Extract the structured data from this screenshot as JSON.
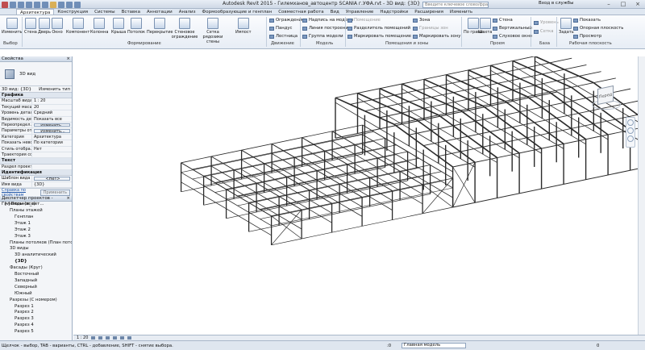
{
  "titlebar": {
    "app_title": "Autodesk Revit 2015 -   Гилемханов_автоцентр SCANIA г.УФА.rvt - 3D вид: {3D}",
    "search_placeholder": "Введите ключевое слово/фразу",
    "login": "Вход в службы"
  },
  "tabs": [
    "Архитектура",
    "Конструкция",
    "Системы",
    "Вставка",
    "Аннотации",
    "Анализ",
    "Формообразующие и генплан",
    "Совместная работа",
    "Вид",
    "Управление",
    "Надстройки",
    "Расширения",
    "Изменить"
  ],
  "active_tab": "Архитектура",
  "ribbon": {
    "modify": "Изменить",
    "select": "Выбор",
    "build": [
      "Стена",
      "Дверь",
      "Окно",
      "Компонент",
      "Колонна",
      "Крыша",
      "Потолок",
      "Перекрытие",
      "Стеновое ограждение",
      "Сетка рядозики стены",
      "Импост"
    ],
    "build_group": "Формирование",
    "circulation": [
      "Ограждение",
      "Пандус",
      "Лестница"
    ],
    "circulation_group": "Движение",
    "model": [
      "Надпись на модели",
      "Линия построения",
      "Группа модели"
    ],
    "model_group": "Модель",
    "room": [
      "Помещение",
      "Разделитель помещений",
      "Маркировать помещение",
      "Зона",
      "Границы зон",
      "Маркировать зону"
    ],
    "room_group": "Помещения и зоны",
    "opening": [
      "По грани",
      "Шахта",
      "Стена",
      "Вертикальный",
      "Слуховое окно"
    ],
    "opening_group": "Проем",
    "datum": [
      "Уровень",
      "Сетка"
    ],
    "datum_group": "База",
    "workplane": [
      "Задать",
      "Показать",
      "Опорная плоскость",
      "Просмотр"
    ],
    "workplane_group": "Рабочая плоскость"
  },
  "properties": {
    "title": "Свойства",
    "type_name": "3D вид",
    "selector": "3D вид: {3D}",
    "edit_type": "Изменить тип",
    "groups": [
      {
        "name": "Графика",
        "rows": [
          [
            "Масштаб вида",
            "1 : 20"
          ],
          [
            "Текущий масш...",
            "20"
          ],
          [
            "Уровень детал...",
            "Средний"
          ],
          [
            "Видимость дет...",
            "Показать все"
          ],
          [
            "Переопредел...",
            "Изменить..."
          ],
          [
            "Параметры от...",
            "Изменить..."
          ],
          [
            "Категория",
            "Архитектура"
          ],
          [
            "Показать нево...",
            "По категории"
          ],
          [
            "Стиль отобра...",
            "Нет"
          ],
          [
            "Траектория со...",
            ""
          ]
        ]
      },
      {
        "name": "Текст",
        "rows": [
          [
            "Раздел проекта",
            ""
          ]
        ]
      },
      {
        "name": "Идентификация",
        "rows": [
          [
            "Шаблон вида",
            "<Нет>"
          ],
          [
            "Имя вида",
            "{3D}"
          ]
        ]
      }
    ],
    "help_link": "Справка по свойствам",
    "apply": "Применить"
  },
  "browser": {
    "title": "Диспетчер проектов - Гилемханов_авт...",
    "items": [
      "[-] Виды (все)",
      "Планы этажей",
      "Генплан",
      "Этаж 1",
      "Этаж 2",
      "Этаж 3",
      "Планы потолков (План пото",
      "3D виды",
      "3D аналитический",
      "{3D}",
      "Фасады (Круг)",
      "Восточный",
      "Западный",
      "Северный",
      "Южный",
      "Разрезы (С номером)",
      "Разрез 1",
      "Разрез 2",
      "Разрез 3",
      "Разрез 4",
      "Разрез 5"
    ]
  },
  "viewcube_label": "Перед",
  "viewbar_scale": "1 : 20",
  "status": {
    "hint": "Щелчок - выбор, TAB - варианты, CTRL - добавление, SHIFT - снятие выбора.",
    "count": ":0",
    "model": "Главная модель",
    "zero": "0"
  }
}
